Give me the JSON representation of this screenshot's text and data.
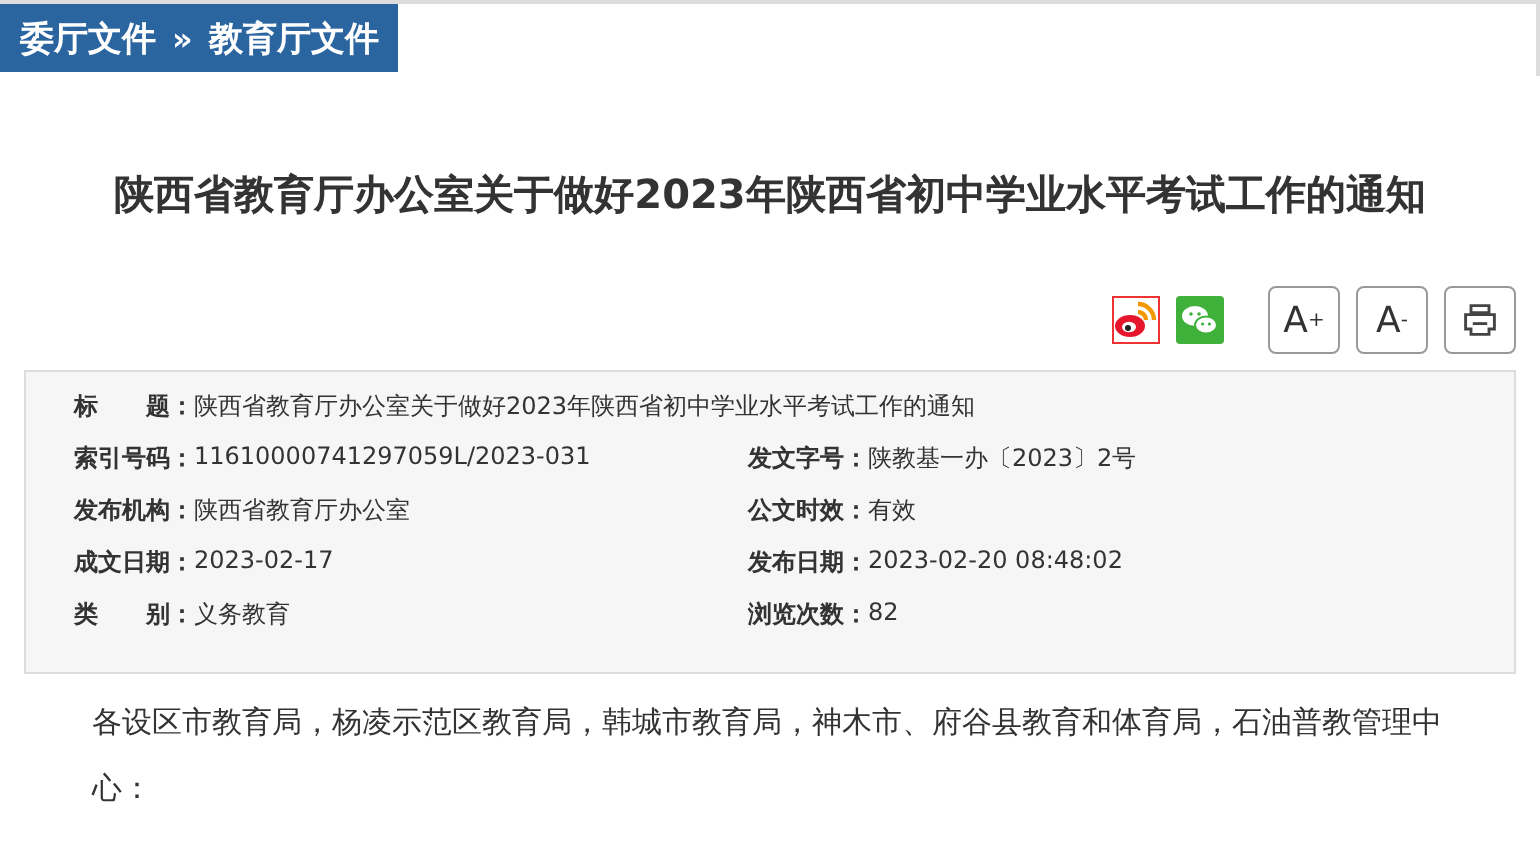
{
  "breadcrumb": {
    "items": [
      "委厅文件",
      "教育厅文件"
    ],
    "separator": "»"
  },
  "article": {
    "title": "陕西省教育厅办公室关于做好2023年陕西省初中学业水平考试工作的通知"
  },
  "toolbar": {
    "font_buttons": [
      "A$^{+}$",
      "A$^{-}$"
    ]
  },
  "info": {
    "title_row": {
      "label": "标　　题：",
      "value": "陕西省教育厅办公室关于做好2023年陕西省初中学业水平考试工作的通知"
    },
    "rows": [
      [
        {
          "label": "索引号码：",
          "value": "11610000741297059L/2023-031"
        },
        {
          "label": "发文字号：",
          "value": "陕教基一办〔2023〕2号"
        }
      ],
      [
        {
          "label": "发布机构：",
          "value": "陕西省教育厅办公室"
        },
        {
          "label": "公文时效：",
          "value": "有效"
        }
      ],
      [
        {
          "label": "成文日期：",
          "value": "2023-02-17"
        },
        {
          "label": "发布日期：",
          "value": "2023-02-20 08:48:02"
        }
      ],
      [
        {
          "label": "类　　别：",
          "value": "义务教育"
        },
        {
          "label": "浏览次数：",
          "value": "82"
        }
      ]
    ]
  },
  "body": {
    "paragraphs": [
      "各设区市教育局，杨凌示范区教育局，韩城市教育局，神木市、府谷县教育和体育局，石油普教管理中心："
    ]
  }
}
